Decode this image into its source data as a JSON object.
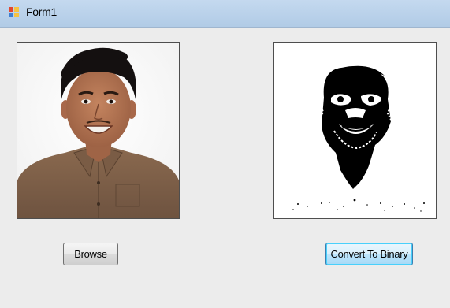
{
  "window": {
    "title": "Form1"
  },
  "buttons": {
    "browse_label": "Browse",
    "convert_label": "Convert To Binary"
  },
  "icons": {
    "app": "form-window-icon"
  },
  "colors": {
    "titlebar": "#b9d1ea",
    "form_background": "#ececec",
    "focused_button_border": "#3c7fb1"
  }
}
